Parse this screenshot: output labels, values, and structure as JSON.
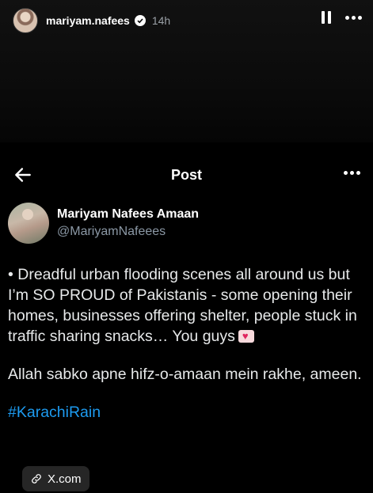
{
  "story": {
    "username": "mariyam.nafees",
    "time": "14h"
  },
  "post_bar": {
    "title": "Post"
  },
  "author": {
    "name": "Mariyam Nafees Amaan",
    "handle": "@MariyamNafeees"
  },
  "tweet": {
    "paragraph1": "• Dreadful urban flooding scenes all around us but I’m SO PROUD of Pakistanis - some opening their homes, businesses offering shelter, people stuck in traffic sharing snacks… You guys",
    "paragraph2": "Allah sabko apne hifz-o-amaan mein rakhe, ameen.",
    "hashtag": "#KarachiRain"
  },
  "link_chip": {
    "label": "X.com"
  },
  "colors": {
    "background": "#000000",
    "text": "#e7e9ea",
    "secondary": "#8b98a5",
    "link": "#1d9bf0"
  },
  "icons": [
    "verified-badge-icon",
    "pause-icon",
    "more-dots-icon",
    "back-arrow-icon",
    "link-icon",
    "heart-emoji-icon"
  ]
}
